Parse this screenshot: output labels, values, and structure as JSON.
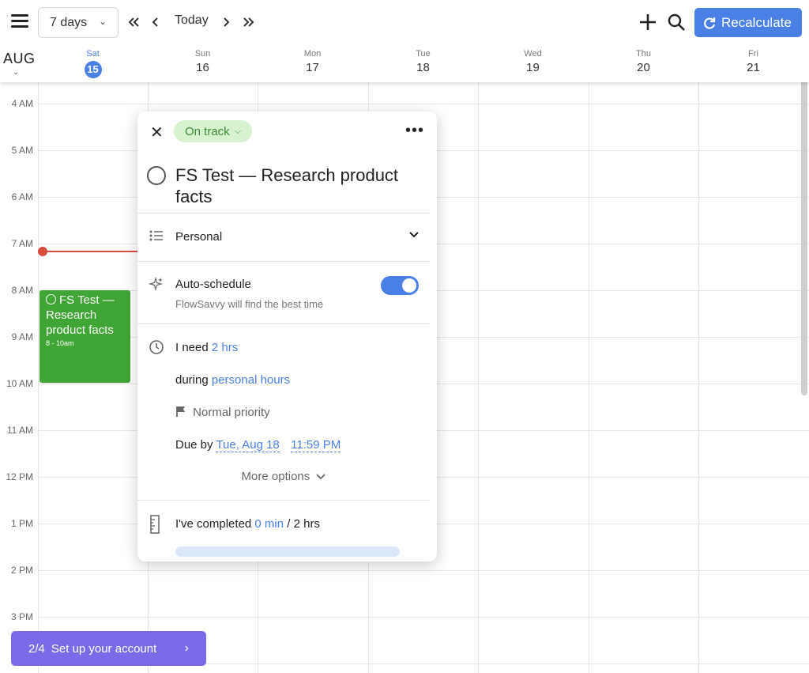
{
  "toolbar": {
    "range_label": "7 days",
    "today_label": "Today",
    "recalculate_label": "Recalculate"
  },
  "calendar": {
    "month": "AUG",
    "days": [
      {
        "name": "Sat",
        "num": "15",
        "today": true
      },
      {
        "name": "Sun",
        "num": "16"
      },
      {
        "name": "Mon",
        "num": "17"
      },
      {
        "name": "Tue",
        "num": "18"
      },
      {
        "name": "Wed",
        "num": "19"
      },
      {
        "name": "Thu",
        "num": "20"
      },
      {
        "name": "Fri",
        "num": "21"
      }
    ],
    "hours": [
      "4 AM",
      "5 AM",
      "6 AM",
      "7 AM",
      "8 AM",
      "9 AM",
      "10 AM",
      "11 AM",
      "12 PM",
      "1 PM",
      "2 PM",
      "3 PM"
    ],
    "event": {
      "title": "FS Test — Research product facts",
      "time": "8 - 10am",
      "color": "#3fa535"
    }
  },
  "popup": {
    "status": "On track",
    "title": "FS Test — Research product facts",
    "list_name": "Personal",
    "auto_schedule_label": "Auto-schedule",
    "auto_schedule_sub": "FlowSavvy will find the best time",
    "auto_schedule_on": true,
    "need_prefix": "I need",
    "need_value": "2 hrs",
    "during_prefix": "during",
    "during_value": "personal hours",
    "priority": "Normal priority",
    "due_prefix": "Due by",
    "due_date": "Tue, Aug 18",
    "due_time": "11:59 PM",
    "more_options": "More options",
    "completed_prefix": "I've completed",
    "completed_value": "0 min",
    "completed_sep": "/",
    "completed_total": "2 hrs",
    "progress": 0
  },
  "setup": {
    "step": "2/4",
    "label": "Set up your account"
  },
  "colors": {
    "accent": "#4a7fe6",
    "event_green": "#3fa535",
    "now_line": "#d94b3f",
    "setup_purple": "#7b6ae8"
  }
}
